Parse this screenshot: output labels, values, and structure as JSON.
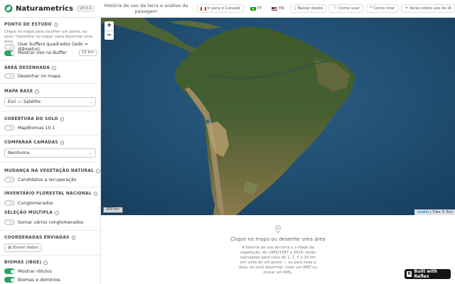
{
  "header": {
    "app_name": "Naturametrics",
    "version": "v0.3.1",
    "subtitle": "História de uso da terra e análise da paisagem",
    "buttons": {
      "canada": "Ir para o Canadá",
      "pt": "PT",
      "en": "EN",
      "download": "Baixar dados",
      "how_to_use": "Como usar",
      "how_to_cite": "Como citar",
      "ai_notice": "Aviso sobre uso de IA"
    }
  },
  "sidebar": {
    "study_point": {
      "title": "PONTO DE ESTUDO",
      "help": "Clique no mapa para escolher um ponto, ou ative \"Desenhar no mapa\" para desenhar uma área.",
      "square_buffers": "Usar buffers quadrados (lado = diâmetro)",
      "show_use_buffer": "Mostrar Uso no Buffer",
      "buffer_km": "10 km"
    },
    "drawn_area": {
      "title": "ÁREA DESENHADA",
      "draw_on_map": "Desenhar no mapa"
    },
    "base_map": {
      "title": "MAPA BASE",
      "selected": "Esri — Satélite"
    },
    "land_cover": {
      "title": "COBERTURA DO SOLO",
      "mapbiomas": "MapBiomas 10.1"
    },
    "compare_layers": {
      "title": "COMPARAR CAMADAS",
      "selected": "Nenhuma"
    },
    "vegetation_change": {
      "title": "MUDANÇA NA VEGETAÇÃO NATURAL",
      "recovery": "Candidatos a recuperação"
    },
    "forest_inventory": {
      "title": "INVENTÁRIO FLORESTAL NACIONAL",
      "clusters": "Conglomerados"
    },
    "multi_select": {
      "title": "SELEÇÃO MÚLTIPLA",
      "sum_clusters": "Somar vários conglomerados"
    },
    "sent_coords": {
      "title": "COORDENADAS ENVIADAS",
      "send_data": "Enviar dados"
    },
    "biomes": {
      "title": "BIOMAS (IBGE)",
      "show_labels": "Mostrar rótulos",
      "biomes_domains": "Biomas e domínios"
    }
  },
  "map": {
    "zoom_in": "+",
    "zoom_out": "−",
    "scale": "300 km",
    "attribution_leaflet": "Leaflet",
    "attribution_rest": "| Tiles © Esri"
  },
  "panel": {
    "title": "Clique no mapa ou desenhe uma área",
    "description": "A história de uso da terra e a idade da vegetação, de 1985/1987 a 2024, serão calculadas para raios de 1, 2, 5 e 10 km em volta de um ponto — ou para toda a área, se você desenhar, colar um WKT ou enviar um KML."
  },
  "badge": {
    "label": "Built with Reflex",
    "mark": "R"
  },
  "colors": {
    "accent_green": "#2e9e63",
    "ocean": "#1f4e71",
    "forest": "#3d5a2a",
    "sand": "#a88f5e"
  }
}
